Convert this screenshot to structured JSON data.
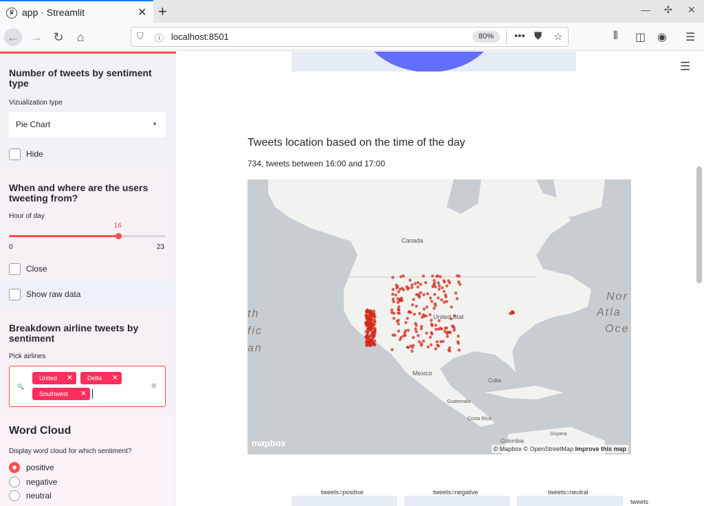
{
  "browser": {
    "tab_title": "app · Streamlit",
    "url": "localhost:8501",
    "zoom": "80%"
  },
  "sidebar": {
    "sentiment_section": {
      "heading": "Number of tweets by sentiment type",
      "select_label": "Vizualization type",
      "select_value": "Pie Chart",
      "hide_label": "Hide"
    },
    "time_section": {
      "heading": "When and where are the users tweeting from?",
      "slider_label": "Hour of day",
      "slider_value": 16,
      "slider_min": 0,
      "slider_max": 23,
      "slider_value_text": "16",
      "slider_min_text": "0",
      "slider_max_text": "23",
      "close_label": "Close",
      "raw_label": "Show raw data"
    },
    "airline_section": {
      "heading": "Breakdown airline tweets by sentiment",
      "pick_label": "Pick airlines",
      "chips": [
        "United",
        "Delta",
        "Southwest"
      ]
    },
    "wordcloud_section": {
      "heading": "Word Cloud",
      "question": "Display word cloud for which sentiment?",
      "options": [
        "positive",
        "negative",
        "neutral"
      ],
      "selected": "positive"
    }
  },
  "main": {
    "map_title": "Tweets location based on the time of the day",
    "map_subtitle": "734, tweets between 16:00 and 17:00",
    "map_labels": {
      "canada": "Canada",
      "mexico": "Mexico",
      "cuba": "Cuba",
      "guatemala": "Guatemala",
      "costa_rica": "Costa Rica",
      "colombia": "Colombia",
      "guyana": "Guyana",
      "north_atlantic_1": "Nor",
      "north_atlantic_2": "Atla",
      "north_atlantic_3": "Oce",
      "pacific_1": "th",
      "pacific_2": "fic",
      "pacific_3": "an",
      "united_states": "United Stat"
    },
    "mapbox_logo": "mapbox",
    "attribution": "© Mapbox © OpenStreetMap",
    "improve": "Improve this map",
    "facets": [
      "tweets=positive",
      "tweets=negative",
      "tweets=neutral"
    ],
    "legend_title": "tweets"
  },
  "colors": {
    "accent": "#ff4b4b",
    "pie": "#636efa",
    "point": "#d42a1b"
  }
}
